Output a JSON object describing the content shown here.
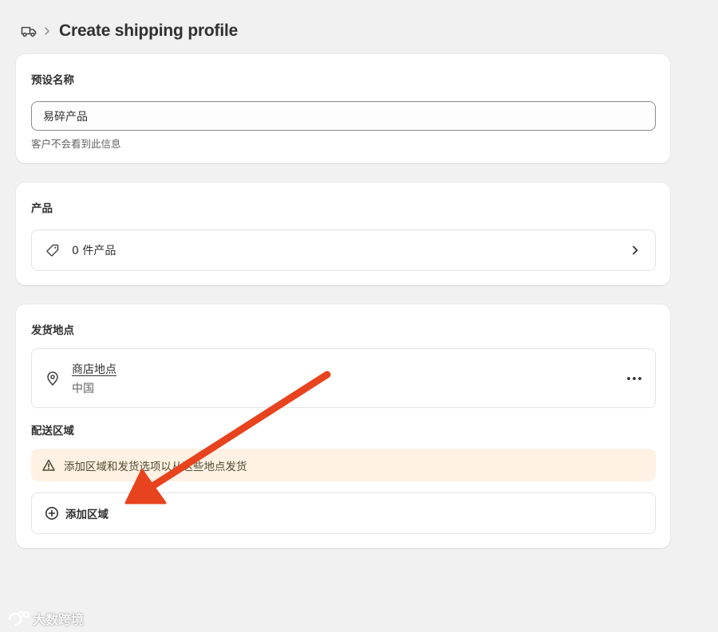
{
  "header": {
    "icon": "truck-icon",
    "separator_icon": "chevron-right-icon",
    "title": "Create shipping profile"
  },
  "name_card": {
    "title": "预设名称",
    "input_value": "易碎产品",
    "help_text": "客户不会看到此信息"
  },
  "products_card": {
    "title": "产品",
    "row_label": "0 件产品",
    "row_icon": "tag-icon"
  },
  "shipping_card": {
    "origin_title": "发货地点",
    "location_name": "商店地点",
    "location_country": "中国",
    "zones_title": "配送区域",
    "banner_text": "添加区域和发货选项以从这些地点发货",
    "add_zone_label": "添加区域"
  },
  "annotation": {
    "arrow_color": "#e8431f"
  },
  "watermark": {
    "text": "大数跨境"
  },
  "colors": {
    "page_bg": "#f1f1f1",
    "card_bg": "#ffffff",
    "banner_bg": "#fff1e3",
    "text": "#303030",
    "muted": "#616161"
  }
}
